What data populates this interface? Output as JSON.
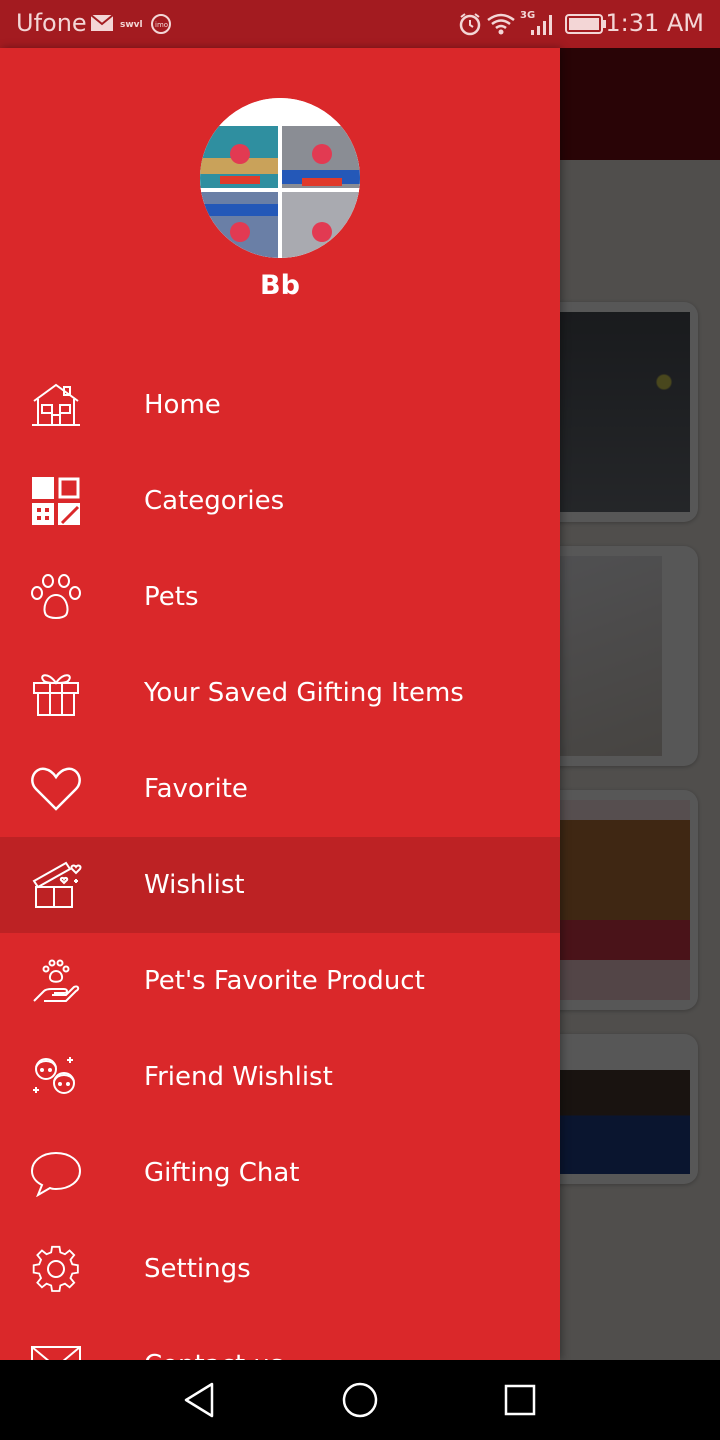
{
  "status_bar": {
    "carrier": "Ufone",
    "network": "3G",
    "time": "1:31 AM",
    "icons": [
      "mail-icon",
      "swvl-icon",
      "imo-icon",
      "alarm-icon",
      "wifi-icon",
      "signal-icon",
      "battery-icon"
    ]
  },
  "drawer": {
    "user_name": "Bb",
    "items": [
      {
        "label": "Home",
        "icon": "home-icon"
      },
      {
        "label": "Categories",
        "icon": "categories-icon"
      },
      {
        "label": "Pets",
        "icon": "paw-icon"
      },
      {
        "label": "Your Saved Gifting Items",
        "icon": "gift-icon"
      },
      {
        "label": "Favorite",
        "icon": "heart-icon"
      },
      {
        "label": "Wishlist",
        "icon": "wishlist-gift-icon",
        "active": true
      },
      {
        "label": "Pet's Favorite Product",
        "icon": "pet-hand-icon"
      },
      {
        "label": "Friend Wishlist",
        "icon": "friends-icon"
      },
      {
        "label": "Gifting Chat",
        "icon": "chat-bubble-icon"
      },
      {
        "label": "Settings",
        "icon": "gear-icon"
      },
      {
        "label": "Contact us",
        "icon": "mail-icon"
      }
    ]
  },
  "navigation_bar": {
    "buttons": [
      "back-icon",
      "home-circle-icon",
      "recents-icon"
    ]
  },
  "colors": {
    "drawer": "#da282a",
    "active_item": "#bd2224",
    "status_bar": "#a31b20",
    "text": "#ffffff"
  }
}
